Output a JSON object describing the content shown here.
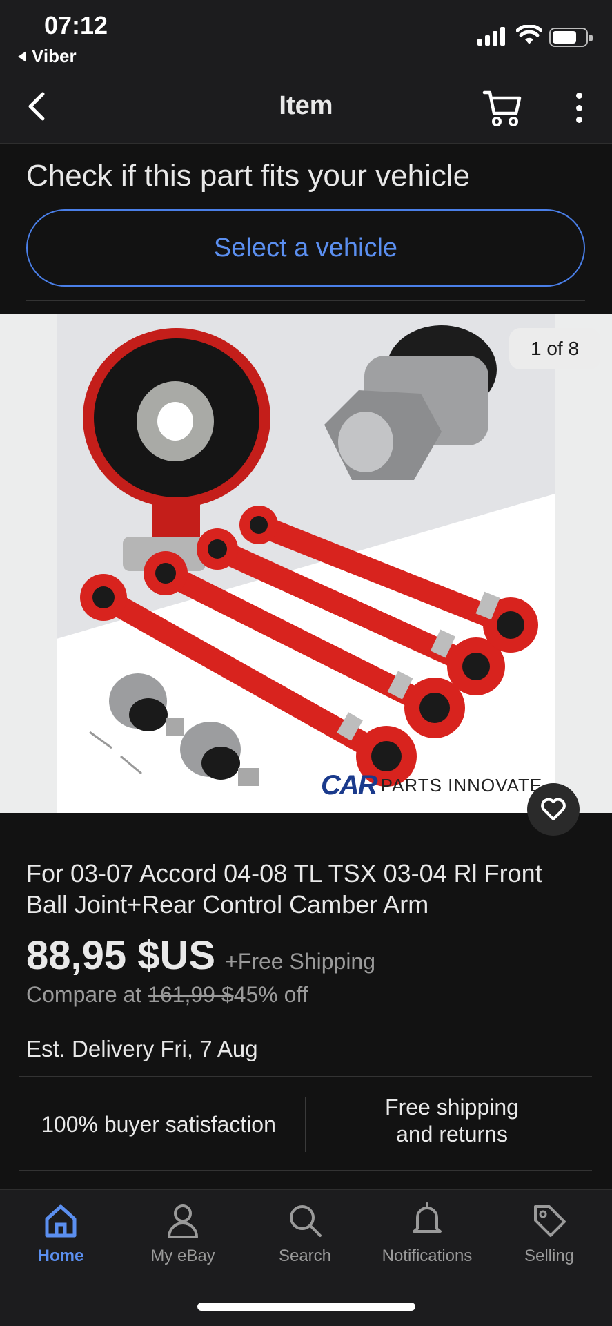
{
  "status_bar": {
    "time": "07:12",
    "back_app": "Viber"
  },
  "nav": {
    "title": "Item"
  },
  "fitment": {
    "heading": "Check if this part fits your vehicle",
    "select_button": "Select a vehicle"
  },
  "gallery": {
    "counter": "1 of 8",
    "watermark_logo": "CAR",
    "watermark_text": "PARTS INNOVATE"
  },
  "listing": {
    "title": "For 03-07 Accord 04-08 TL TSX 03-04 Rl Front Ball Joint+Rear Control Camber Arm",
    "price": "88,95 $US",
    "shipping": "+Free Shipping",
    "compare_prefix": "Compare at",
    "compare_price": "161,99 $",
    "discount": "45% off",
    "delivery_label": "Est. Delivery",
    "delivery_date": "Fri, 7 Aug"
  },
  "perks": {
    "left": "100% buyer satisfaction",
    "right_line1": "Free shipping",
    "right_line2": "and returns"
  },
  "tabs": [
    {
      "label": "Home",
      "icon": "home-icon",
      "active": true
    },
    {
      "label": "My eBay",
      "icon": "person-icon",
      "active": false
    },
    {
      "label": "Search",
      "icon": "search-icon",
      "active": false
    },
    {
      "label": "Notifications",
      "icon": "bell-icon",
      "active": false
    },
    {
      "label": "Selling",
      "icon": "tag-icon",
      "active": false
    }
  ],
  "colors": {
    "accent": "#5b8ff0",
    "background": "#121212",
    "bar": "#1c1c1e",
    "product_red": "#d8231e"
  }
}
